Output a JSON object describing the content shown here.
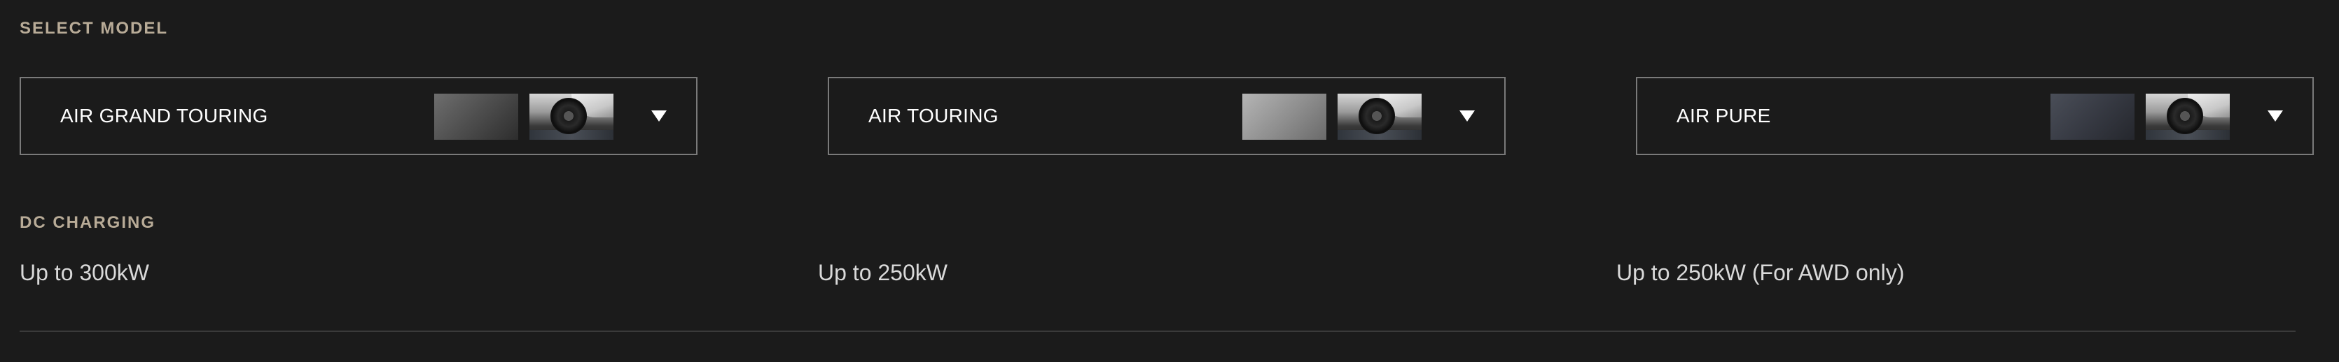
{
  "select_model": {
    "label": "SELECT MODEL",
    "models": [
      {
        "name": "AIR GRAND TOURING",
        "paint_color": "#5a5a5a"
      },
      {
        "name": "AIR TOURING",
        "paint_color": "#9b9b9b"
      },
      {
        "name": "AIR PURE",
        "paint_color": "#3a3d45"
      }
    ]
  },
  "dc_charging": {
    "label": "DC CHARGING",
    "values": [
      "Up to 300kW",
      "Up to 250kW",
      "Up to 250kW (For AWD only)"
    ]
  },
  "icons": {
    "dropdown": "chevron-down-icon",
    "paint_swatch": "paint-swatch-icon",
    "wheel_swatch": "wheel-image-icon"
  }
}
